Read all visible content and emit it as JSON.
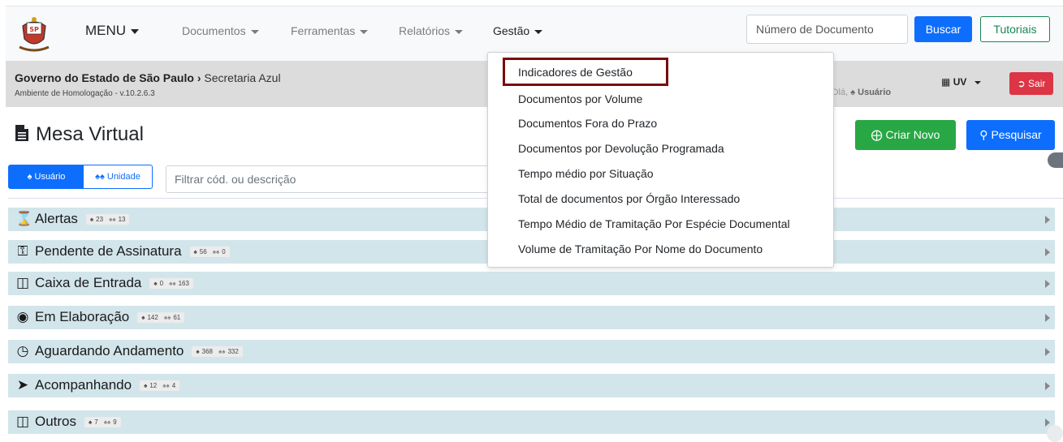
{
  "navbar": {
    "menu_label": "MENU",
    "links": [
      "Documentos",
      "Ferramentas",
      "Relatórios",
      "Gestão"
    ],
    "search_placeholder": "Número de Documento",
    "search_button": "Buscar",
    "tutorials_button": "Tutoriais"
  },
  "subheader": {
    "org": "Governo do Estado de São Paulo",
    "org_sep": "›",
    "secretaria": "Secretaria Azul",
    "env": "Ambiente de Homologação - v.10.2.6.3",
    "greeting": "Olá,",
    "user": "Usuário",
    "uv": "UV",
    "logout": "Sair"
  },
  "page": {
    "title": "Mesa Virtual",
    "create_button": "Criar Novo",
    "search_button": "Pesquisar"
  },
  "filter": {
    "tab_user": "Usuário",
    "tab_unit": "Unidade",
    "placeholder": "Filtrar cód. ou descrição"
  },
  "rows": [
    {
      "label": "Alertas",
      "icon": "hourglass-icon",
      "user": "23",
      "unit": "13"
    },
    {
      "label": "Pendente de Assinatura",
      "icon": "key-icon",
      "user": "56",
      "unit": "0"
    },
    {
      "label": "Caixa de Entrada",
      "icon": "inbox-icon",
      "user": "0",
      "unit": "163"
    },
    {
      "label": "Em Elaboração",
      "icon": "lightbulb-icon",
      "user": "142",
      "unit": "61"
    },
    {
      "label": "Aguardando Andamento",
      "icon": "clock-icon",
      "user": "368",
      "unit": "332"
    },
    {
      "label": "Acompanhando",
      "icon": "tags-icon",
      "user": "12",
      "unit": "4"
    },
    {
      "label": "Outros",
      "icon": "inbox-icon",
      "user": "7",
      "unit": "9"
    }
  ],
  "dropdown": {
    "items": [
      "Indicadores de Gestão",
      "Documentos por Volume",
      "Documentos Fora do Prazo",
      "Documentos por Devolução Programada",
      "Tempo médio por Situação",
      "Total de documentos por Órgão Interessado",
      "Tempo Médio de Tramitação Por Espécie Documental",
      "Volume de Tramitação Por Nome do Documento"
    ]
  },
  "colors": {
    "primary": "#0d6efd",
    "success": "#28a745",
    "danger": "#dc3545",
    "row_bg": "#d2e5eb",
    "highlight": "#7a0b0b"
  }
}
